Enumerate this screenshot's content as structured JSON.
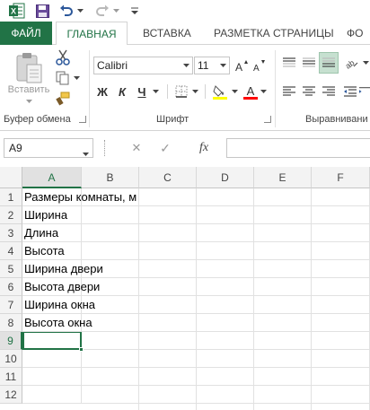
{
  "quick_access": {
    "icons": [
      "excel-logo-icon",
      "save-icon",
      "undo-icon",
      "undo-dropdown-icon",
      "redo-icon",
      "redo-dropdown-icon",
      "customize-qat-icon"
    ],
    "excel_letter": "X"
  },
  "ribbon_tabs": [
    "ФАЙЛ",
    "ГЛАВНАЯ",
    "ВСТАВКА",
    "РАЗМЕТКА СТРАНИЦЫ",
    "ФО"
  ],
  "clipboard": {
    "paste_label": "Вставить",
    "group_label": "Буфер обмена"
  },
  "font": {
    "name": "Calibri",
    "size": "11",
    "bold": "Ж",
    "italic": "К",
    "underline": "Ч",
    "group_label": "Шрифт",
    "highlight_color": "#ffff00",
    "font_color": "#ff0000"
  },
  "alignment": {
    "group_label": "Выравнивани"
  },
  "formula_bar": {
    "name_box": "A9",
    "fx_label": "fx",
    "cancel_symbol": "✕",
    "enter_symbol": "✓",
    "formula": ""
  },
  "grid": {
    "columns": [
      "A",
      "B",
      "C",
      "D",
      "E",
      "F"
    ],
    "rows": [
      "1",
      "2",
      "3",
      "4",
      "5",
      "6",
      "7",
      "8",
      "9",
      "10",
      "11",
      "12"
    ],
    "cells_a": [
      "Размеры комнаты, м",
      "Ширина",
      "Длина",
      "Высота",
      "Ширина двери",
      "Высота двери",
      "Ширина окна",
      "Высота окна",
      "",
      "",
      "",
      ""
    ],
    "selected_cell": "A9",
    "accent": "#217346"
  }
}
